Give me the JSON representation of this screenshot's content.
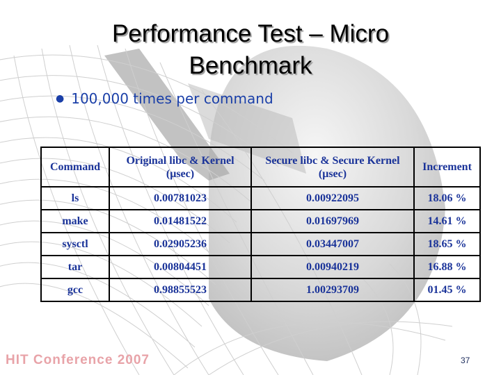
{
  "slide": {
    "title_line1": "Performance Test – Micro",
    "title_line2": "Benchmark",
    "bullets": [
      {
        "icon": "bullet-dot",
        "text": "100,000 times per command"
      }
    ],
    "table": {
      "headers": [
        {
          "line1": "Command",
          "line2": ""
        },
        {
          "line1": "Original libc & Kernel",
          "line2": "(μsec)"
        },
        {
          "line1": "Secure libc & Secure Kernel",
          "line2": "(μsec)"
        },
        {
          "line1": "Increment",
          "line2": ""
        }
      ],
      "rows": [
        [
          "ls",
          "0.00781023",
          "0.00922095",
          "18.06 %"
        ],
        [
          "make",
          "0.01481522",
          "0.01697969",
          "14.61 %"
        ],
        [
          "sysctl",
          "0.02905236",
          "0.03447007",
          "18.65 %"
        ],
        [
          "tar",
          "0.00804451",
          "0.00940219",
          "16.88 %"
        ],
        [
          "gcc",
          "0.98855523",
          "1.00293709",
          "01.45 %"
        ]
      ]
    },
    "footer_brand": "HIT Conference 2007",
    "page_number": "37"
  },
  "colors": {
    "text_blue": "#1a3399",
    "bullet_blue": "#1a3fa8",
    "footer_pink": "#e8a3a8"
  }
}
